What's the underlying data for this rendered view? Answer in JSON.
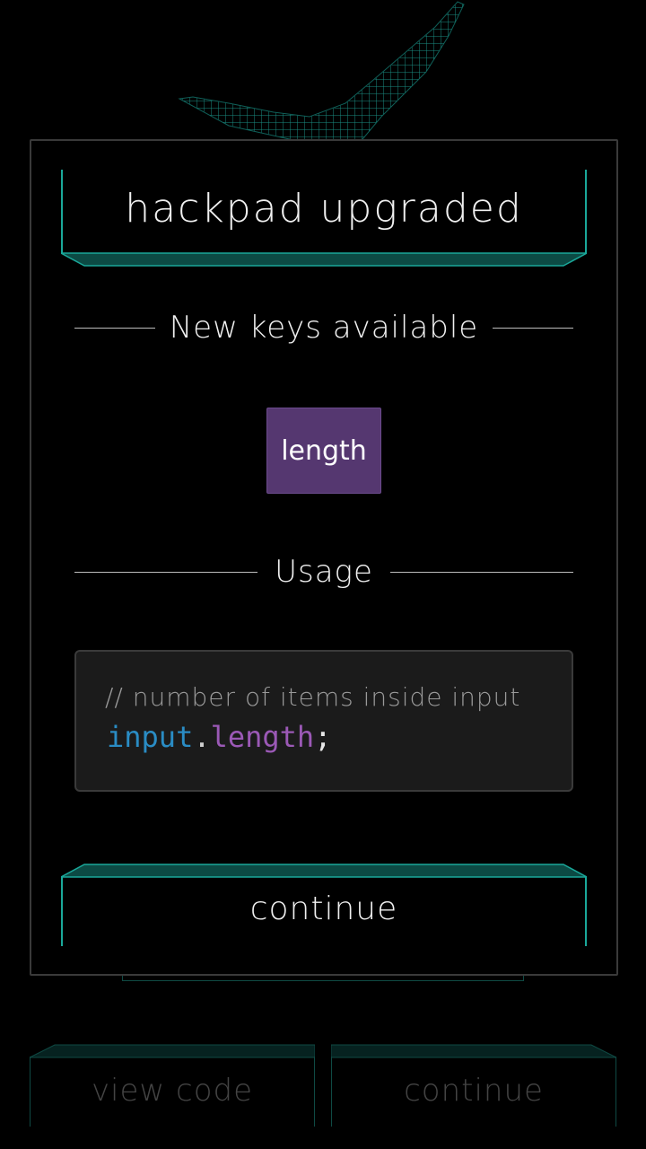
{
  "modal": {
    "title": "hackpad upgraded",
    "new_keys_heading": "New keys available",
    "keys": [
      "length"
    ],
    "usage_heading": "Usage",
    "code": {
      "comment": "// number of items inside input",
      "object": "input",
      "dot": ".",
      "property": "length",
      "semicolon": ";"
    },
    "continue_label": "continue"
  },
  "background": {
    "view_code_label": "view code",
    "continue_label": "continue"
  },
  "colors": {
    "accent_teal": "#1aa89a",
    "key_purple": "#553770",
    "code_object": "#2a8cc4",
    "code_property": "#9b59b6"
  }
}
